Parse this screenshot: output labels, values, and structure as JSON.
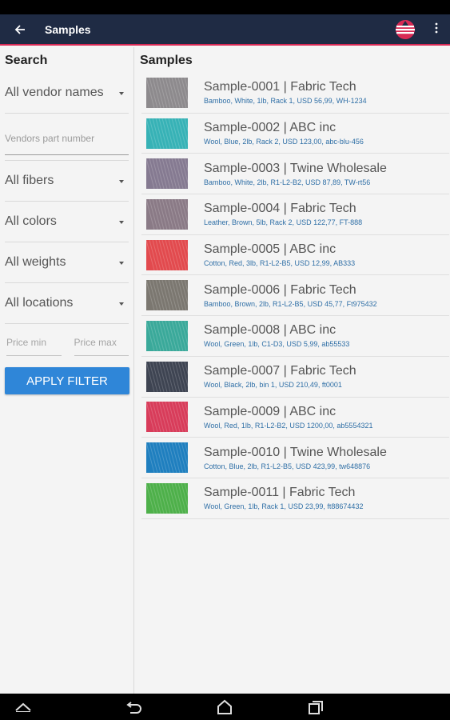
{
  "appbar": {
    "title": "Samples"
  },
  "filters": {
    "heading": "Search",
    "vendor": "All vendor names",
    "part_placeholder": "Vendors part number",
    "fibers": "All fibers",
    "colors": "All colors",
    "weights": "All weights",
    "locations": "All locations",
    "price_min_placeholder": "Price min",
    "price_max_placeholder": "Price max",
    "apply_label": "APPLY FILTER"
  },
  "samples": {
    "heading": "Samples",
    "items": [
      {
        "title": "Sample-0001 | Fabric Tech",
        "details": "Bamboo, White, 1lb, Rack 1, USD 56,99, WH-1234",
        "swatch": "#8d8a8d"
      },
      {
        "title": "Sample-0002 | ABC inc",
        "details": "Wool, Blue, 2lb, Rack 2, USD 123,00, abc-blu-456",
        "swatch": "#37b2b6"
      },
      {
        "title": "Sample-0003 | Twine Wholesale",
        "details": "Bamboo, White, 2lb, R1-L2-B2, USD 87,89, TW-rt56",
        "swatch": "#857a91"
      },
      {
        "title": "Sample-0004 | Fabric Tech",
        "details": "Leather, Brown, 5lb, Rack 2, USD 122,77, FT-888",
        "swatch": "#8a7a86"
      },
      {
        "title": "Sample-0005 | ABC inc",
        "details": "Cotton, Red, 3lb, R1-L2-B5, USD 12,99, AB333",
        "swatch": "#e24a4e"
      },
      {
        "title": "Sample-0006 | Fabric Tech",
        "details": "Bamboo, Brown, 2lb, R1-L2-B5, USD 45,77, Ft975432",
        "swatch": "#7b7770"
      },
      {
        "title": "Sample-0008 | ABC inc",
        "details": "Wool, Green, 1lb, C1-D3, USD 5,99, ab55533",
        "swatch": "#3aa99a"
      },
      {
        "title": "Sample-0007 | Fabric Tech",
        "details": "Wool, Black, 2lb, bin 1, USD 210,49, ft0001",
        "swatch": "#3e4452"
      },
      {
        "title": "Sample-0009 | ABC inc",
        "details": "Wool, Red, 1lb, R1-L2-B2, USD 1200,00, ab5554321",
        "swatch": "#d83c5a"
      },
      {
        "title": "Sample-0010 | Twine Wholesale",
        "details": "Cotton, Blue, 2lb, R1-L2-B5, USD 423,99, tw648876",
        "swatch": "#1f7fbf"
      },
      {
        "title": "Sample-0011 | Fabric Tech",
        "details": "Wool, Green, 1lb, Rack 1, USD 23,99, ft88674432",
        "swatch": "#4eb04a"
      }
    ]
  },
  "colors": {
    "appbar": "#1f2b44",
    "accent": "#d92a55",
    "button": "#2f86d8",
    "detail_text": "#2f6fa6"
  }
}
